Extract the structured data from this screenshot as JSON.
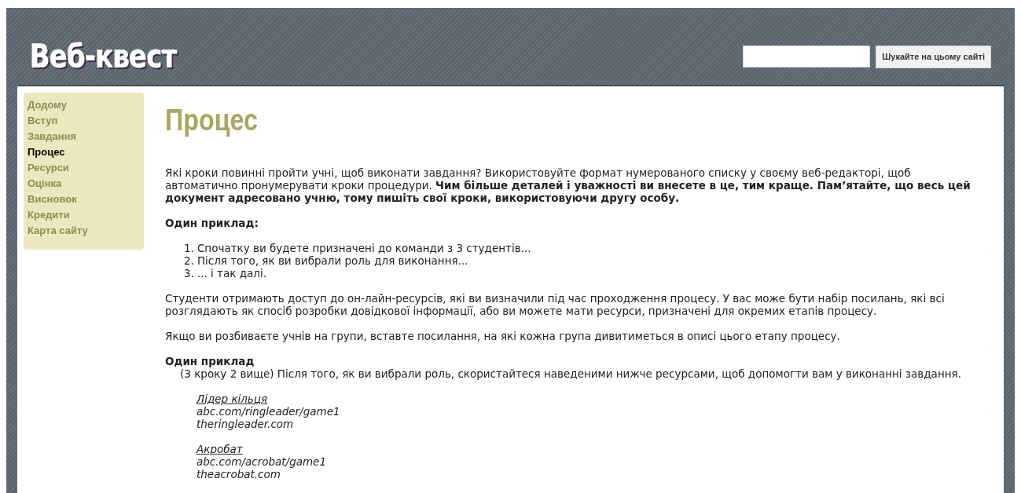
{
  "header": {
    "logo": "Веб-квест",
    "search": {
      "button": "Шукайте на цьому сайті"
    }
  },
  "sidebar": {
    "items": [
      {
        "label": "Додому",
        "selected": false
      },
      {
        "label": "Вступ",
        "selected": false
      },
      {
        "label": "Завдання",
        "selected": false
      },
      {
        "label": "Процес",
        "selected": true
      },
      {
        "label": "Ресурси",
        "selected": false
      },
      {
        "label": "Оцінка",
        "selected": false
      },
      {
        "label": "Висновок",
        "selected": false
      },
      {
        "label": "Кредити",
        "selected": false
      },
      {
        "label": "Карта сайту",
        "selected": false
      }
    ]
  },
  "content": {
    "title": "Процес",
    "blocks": [
      {
        "kind": "paragraph",
        "text": "Які кроки повинні пройти учні, щоб виконати завдання? Використовуйте формат нумерованого списку у своєму веб-редакторі, щоб автоматично пронумерувати кроки процедури. **Чим більше деталей і уважності ви внесете в це, тим краще. Пам’ятайте, що весь цей документ адресовано учню, тому пишіть свої кроки, використовуючи другу особу.**"
      },
      {
        "kind": "heading",
        "text": "Один приклад:"
      },
      {
        "kind": "list",
        "items": [
          {
            "number": "1.",
            "text": "Спочатку ви будете призначені до команди з 3 студентів..."
          },
          {
            "number": "2.",
            "text": "Після того, як ви вибрали роль для виконання..."
          },
          {
            "number": "3.",
            "text": "... і так далі."
          }
        ]
      },
      {
        "kind": "paragraph",
        "text": "Студенти отримають доступ до он-лайн-ресурсів, які ви визначили під час проходження процесу. У вас може бути набір посилань, які всі розглядають як спосіб розробки довідкової інформації, або ви можете мати ресурси, призначені для окремих етапів процесу."
      },
      {
        "kind": "paragraph",
        "text": "Якщо ви розбиваєте учнів на групи, вставте посилання, на які кожна група дивитиметься в описі цього етапу процесу."
      },
      {
        "kind": "example",
        "heading": "Один приклад",
        "text": "(З кроку 2 вище) Після того, як ви вибрали роль, скористайтеся наведеними нижче ресурсами, щоб допомогти вам у виконанні завдання."
      },
      {
        "kind": "resource",
        "link": "Лідер кільця",
        "lines": [
          "abc.com/ringleader/game1",
          "theringleader.com"
        ]
      },
      {
        "kind": "resource",
        "link": "Акробат",
        "lines": [
          "abc.com/acrobat/game1",
          "theacrobat.com"
        ]
      }
    ]
  }
}
